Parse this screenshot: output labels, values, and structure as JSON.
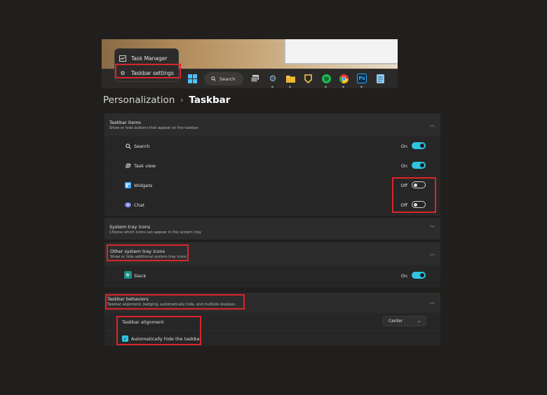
{
  "context_menu": {
    "items": [
      {
        "label": "Task Manager",
        "icon": "task-manager-icon"
      },
      {
        "label": "Taskbar settings",
        "icon": "gear-icon"
      }
    ]
  },
  "taskbar": {
    "search_label": "Search",
    "ps_label": "Ps"
  },
  "breadcrumb": {
    "parent": "Personalization",
    "separator": "›",
    "current": "Taskbar"
  },
  "taskbar_items": {
    "title": "Taskbar items",
    "subtitle": "Show or hide buttons that appear on the taskbar",
    "rows": [
      {
        "label": "Search",
        "state": "On",
        "on": true,
        "icon": "search-icon"
      },
      {
        "label": "Task view",
        "state": "On",
        "on": true,
        "icon": "task-view-icon"
      },
      {
        "label": "Widgets",
        "state": "Off",
        "on": false,
        "icon": "widgets-icon"
      },
      {
        "label": "Chat",
        "state": "Off",
        "on": false,
        "icon": "chat-icon"
      }
    ]
  },
  "system_tray": {
    "title": "System tray icons",
    "subtitle": "Choose which icons can appear in the system tray"
  },
  "other_tray": {
    "title": "Other system tray icons",
    "subtitle": "Show or hide additional system tray icons",
    "rows": [
      {
        "label": "Slack",
        "state": "On",
        "on": true,
        "icon": "slack-icon"
      }
    ]
  },
  "behaviors": {
    "title": "Taskbar behaviors",
    "subtitle": "Taskbar alignment, badging, automatically hide, and multiple displays",
    "alignment_label": "Taskbar alignment",
    "alignment_value": "Center",
    "autohide_label": "Automatically hide the taskbar",
    "autohide_checked": true
  },
  "colors": {
    "accent": "#2ec5e3",
    "highlight": "#d8262c",
    "background": "#211f1d"
  }
}
